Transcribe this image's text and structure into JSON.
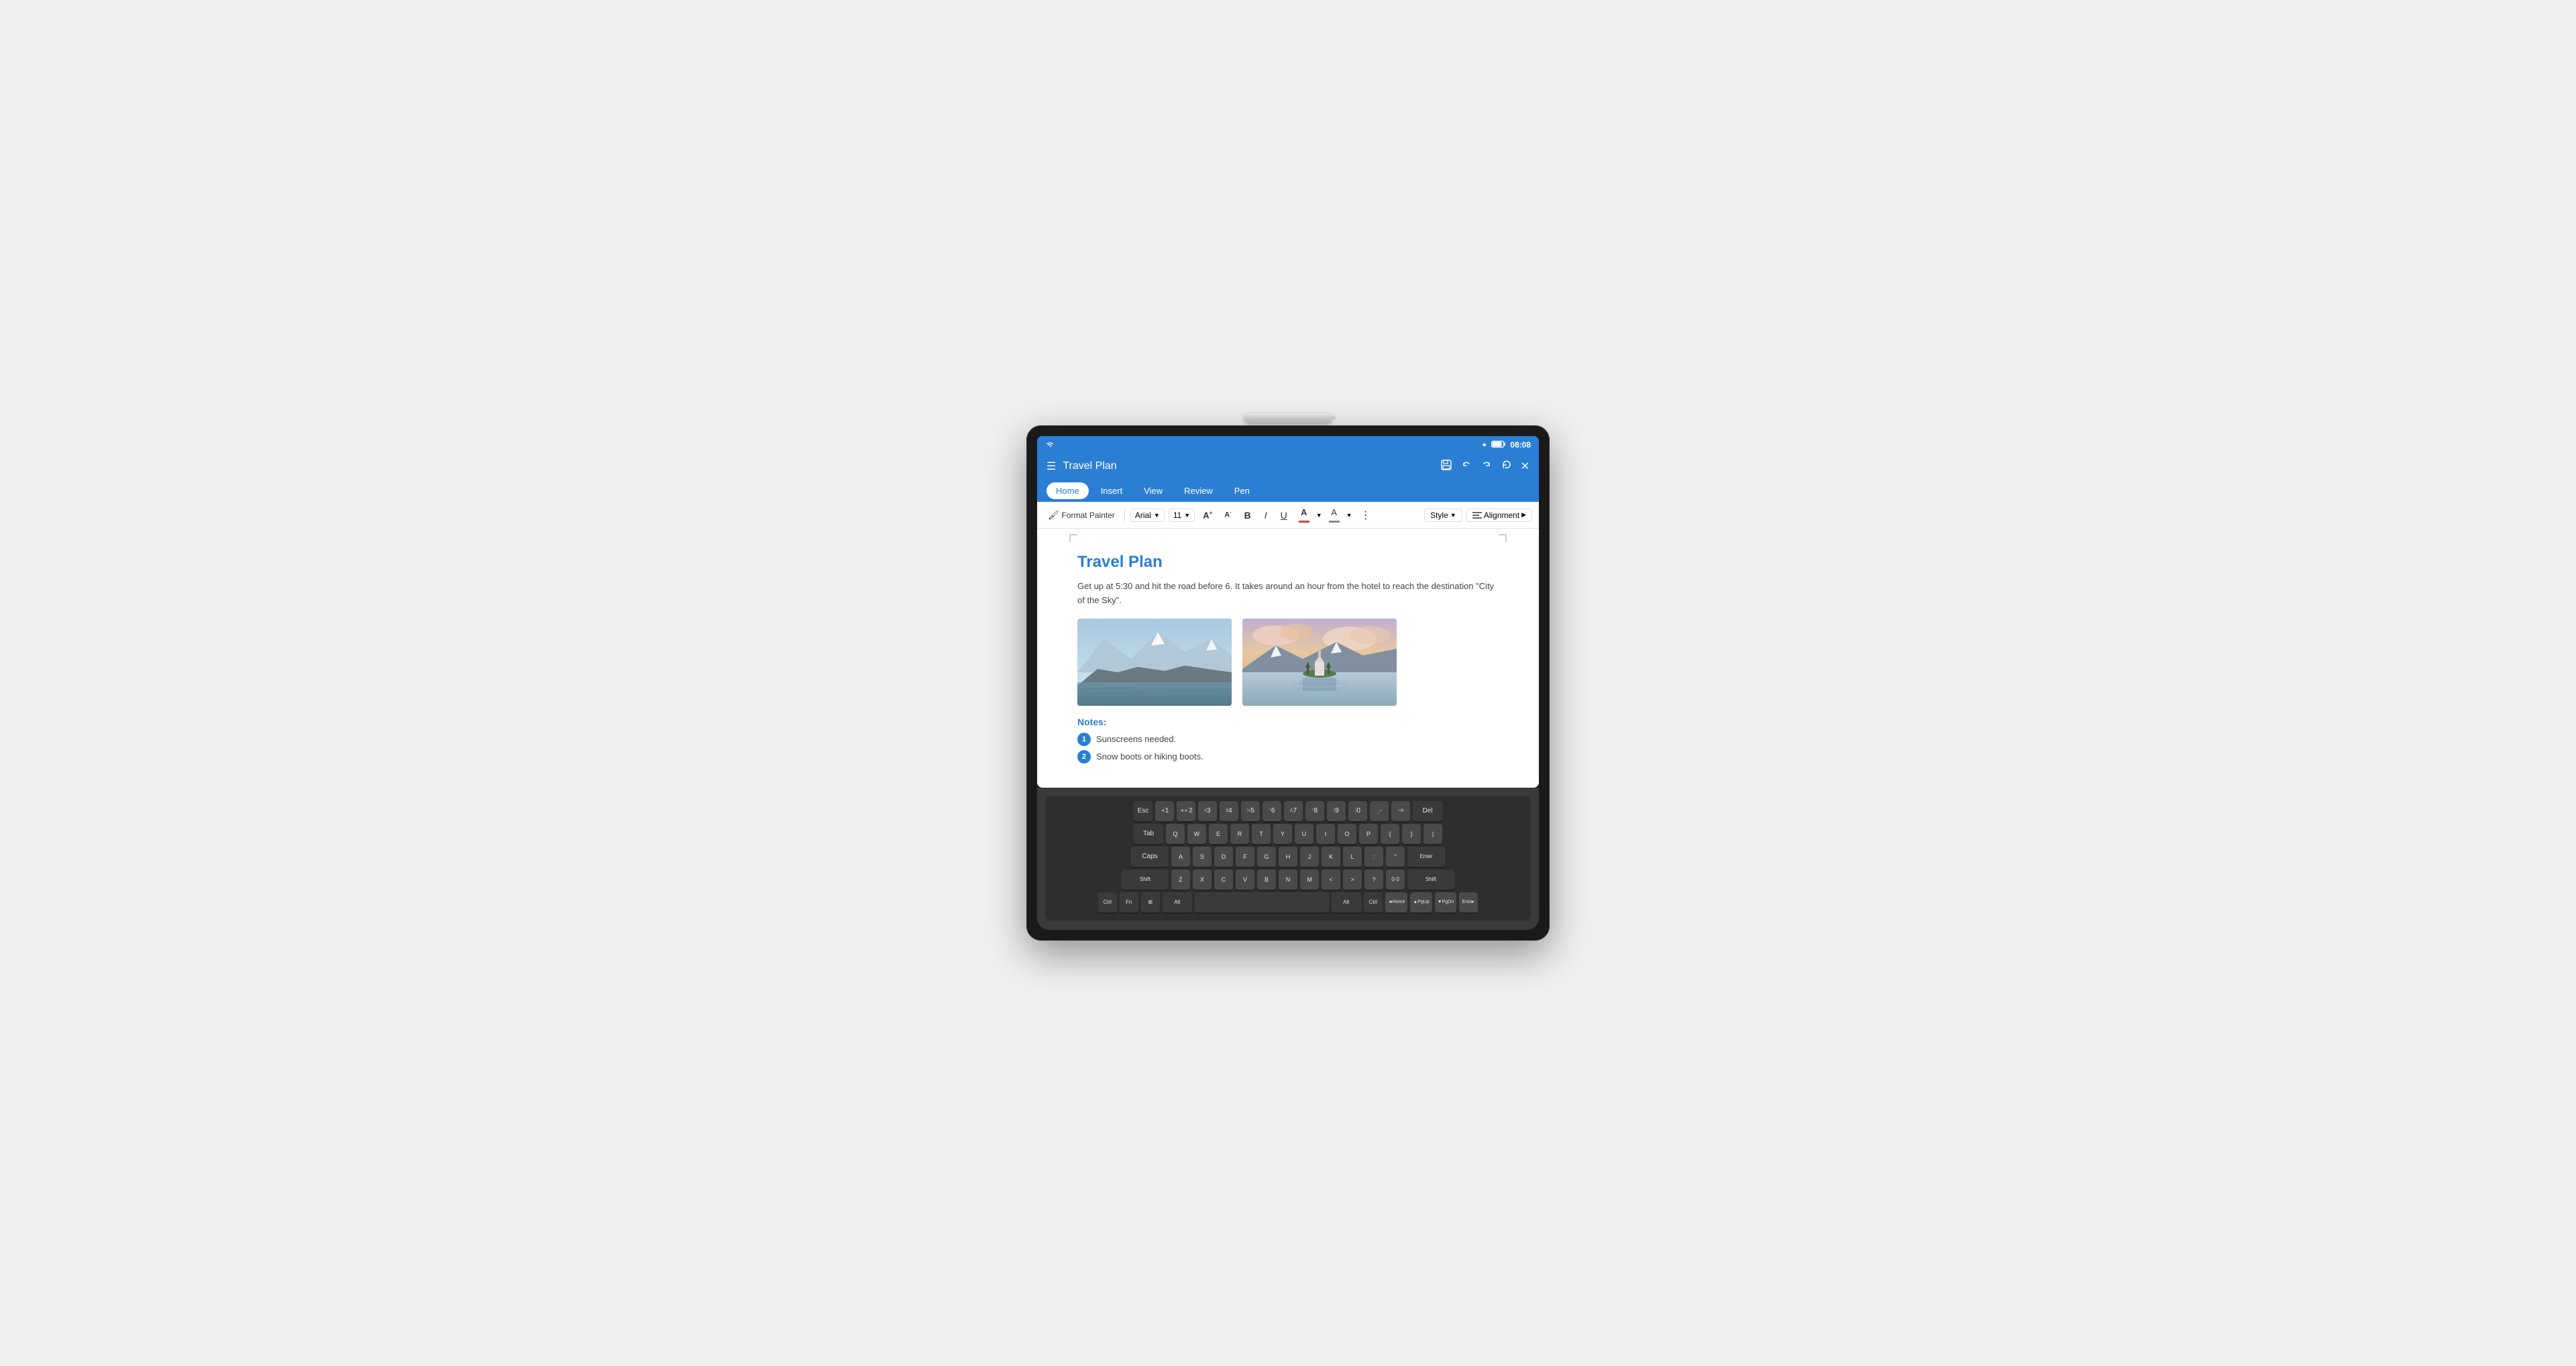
{
  "device": {
    "status_bar": {
      "wifi": "▲",
      "battery": "🔋",
      "time": "08:08"
    },
    "title_bar": {
      "menu_icon": "☰",
      "title": "Travel Plan",
      "actions": [
        "⬜",
        "↩",
        "↪",
        "⟳",
        "✕"
      ]
    },
    "tabs": [
      {
        "label": "Home",
        "active": true
      },
      {
        "label": "Insert",
        "active": false
      },
      {
        "label": "View",
        "active": false
      },
      {
        "label": "Review",
        "active": false
      },
      {
        "label": "Pen",
        "active": false
      }
    ],
    "toolbar": {
      "format_painter": "Format Painter",
      "font_name": "Arial",
      "font_size": "11",
      "grow_icon": "A↑",
      "shrink_icon": "A↓",
      "bold": "B",
      "italic": "I",
      "underline": "U",
      "font_color_label": "A",
      "font_color": "#e63c3c",
      "highlight_label": "A",
      "highlight_color": "#888888",
      "more": "⋮",
      "style": "Style",
      "alignment": "Alignment"
    }
  },
  "document": {
    "title": "Travel Plan",
    "body": "Get up at 5:30 and hit the road before 6. It takes around an hour from the hotel\nto reach the destination \"City of the Sky\".",
    "notes_title": "Notes:",
    "notes": [
      {
        "number": "1",
        "text": "Sunscreens needed."
      },
      {
        "number": "2",
        "text": "Snow boots or hiking boots."
      }
    ]
  },
  "keyboard": {
    "rows": [
      [
        "Esc",
        "1",
        "2",
        "3",
        "4",
        "5",
        "6",
        "7",
        "8",
        "9",
        "0",
        "-",
        "=",
        "Del"
      ],
      [
        "Tab",
        "Q",
        "W",
        "E",
        "R",
        "T",
        "Y",
        "U",
        "I",
        "O",
        "P",
        "[",
        "]",
        "\\"
      ],
      [
        "Caps",
        "A",
        "S",
        "D",
        "F",
        "G",
        "H",
        "J",
        "K",
        "L",
        ";",
        "'",
        "Enter"
      ],
      [
        "Shift",
        "Z",
        "X",
        "C",
        "V",
        "B",
        "N",
        "M",
        "<",
        ">",
        "?",
        "/ ",
        "Shift"
      ],
      [
        "Ctrl",
        "Fn",
        "⊞",
        "Alt",
        "",
        "Alt",
        "Ctrl",
        "◄Home",
        "▲PgUp",
        "▼PgDn",
        "End►"
      ]
    ]
  }
}
